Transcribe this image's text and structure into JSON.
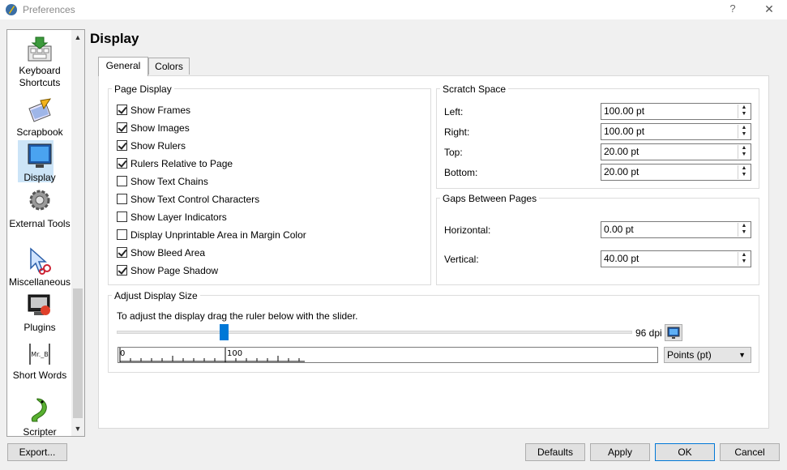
{
  "window": {
    "title": "Preferences",
    "help": "?",
    "close": "✕"
  },
  "sidebar": {
    "items": [
      {
        "label": "Keyboard Shortcuts",
        "icon": "keyboard-icon"
      },
      {
        "label": "Scrapbook",
        "icon": "scrapbook-icon"
      },
      {
        "label": "Display",
        "icon": "monitor-icon",
        "selected": true
      },
      {
        "label": "External Tools",
        "icon": "gear-icon"
      },
      {
        "label": "Miscellaneous",
        "icon": "tools-icon"
      },
      {
        "label": "Plugins",
        "icon": "plugins-icon"
      },
      {
        "label": "Short Words",
        "icon": "short-words-icon"
      },
      {
        "label": "Scripter",
        "icon": "python-icon"
      }
    ],
    "up": "▲",
    "down": "▼"
  },
  "page": {
    "title": "Display"
  },
  "tabs": {
    "general": "General",
    "colors": "Colors"
  },
  "page_display": {
    "title": "Page Display",
    "options": [
      {
        "label": "Show Frames",
        "checked": true
      },
      {
        "label": "Show Images",
        "checked": true
      },
      {
        "label": "Show Rulers",
        "checked": true
      },
      {
        "label": "Rulers Relative to Page",
        "checked": true
      },
      {
        "label": "Show Text Chains",
        "checked": false
      },
      {
        "label": "Show Text Control Characters",
        "checked": false
      },
      {
        "label": "Show Layer Indicators",
        "checked": false
      },
      {
        "label": "Display Unprintable Area in Margin Color",
        "checked": false
      },
      {
        "label": "Show Bleed Area",
        "checked": true
      },
      {
        "label": "Show Page Shadow",
        "checked": true
      }
    ]
  },
  "scratch_space": {
    "title": "Scratch Space",
    "fields": [
      {
        "label": "Left:",
        "value": "100.00 pt"
      },
      {
        "label": "Right:",
        "value": "100.00 pt"
      },
      {
        "label": "Top:",
        "value": "20.00 pt"
      },
      {
        "label": "Bottom:",
        "value": "20.00 pt"
      }
    ]
  },
  "gaps": {
    "title": "Gaps Between Pages",
    "fields": [
      {
        "label": "Horizontal:",
        "value": "0.00 pt"
      },
      {
        "label": "Vertical:",
        "value": "40.00 pt"
      }
    ]
  },
  "adjust": {
    "title": "Adjust Display Size",
    "instruction": "To adjust the display drag the ruler below with the slider.",
    "dpi": "96 dpi",
    "slider_fraction": 0.2,
    "ruler_labels": [
      "0",
      "100"
    ],
    "unit": "Points (pt)",
    "unit_arrow": "▼"
  },
  "buttons": {
    "export": "Export...",
    "defaults": "Defaults",
    "apply": "Apply",
    "ok": "OK",
    "cancel": "Cancel"
  }
}
